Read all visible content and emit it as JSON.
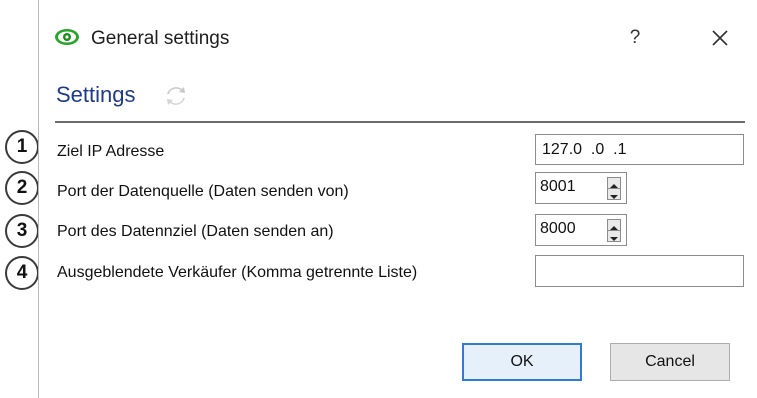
{
  "dialog": {
    "title": "General settings",
    "help_label": "?",
    "close_icon": "close-icon",
    "app_icon": "eye-icon",
    "accent_color": "#2f7bd6"
  },
  "section": {
    "title": "Settings",
    "icon": "refresh-icon",
    "title_color": "#1f3a8a"
  },
  "rows": [
    {
      "number": "1",
      "label": "Ziel IP Adresse",
      "value": "127.0  .0  .1"
    },
    {
      "number": "2",
      "label": "Port der Datenquelle (Daten senden von)",
      "value": "8001"
    },
    {
      "number": "3",
      "label": "Port des Datennziel (Daten senden an)",
      "value": "8000"
    },
    {
      "number": "4",
      "label": "Ausgeblendete Verkäufer (Komma getrennte Liste)",
      "value": ""
    }
  ],
  "buttons": {
    "ok": "OK",
    "cancel": "Cancel"
  }
}
